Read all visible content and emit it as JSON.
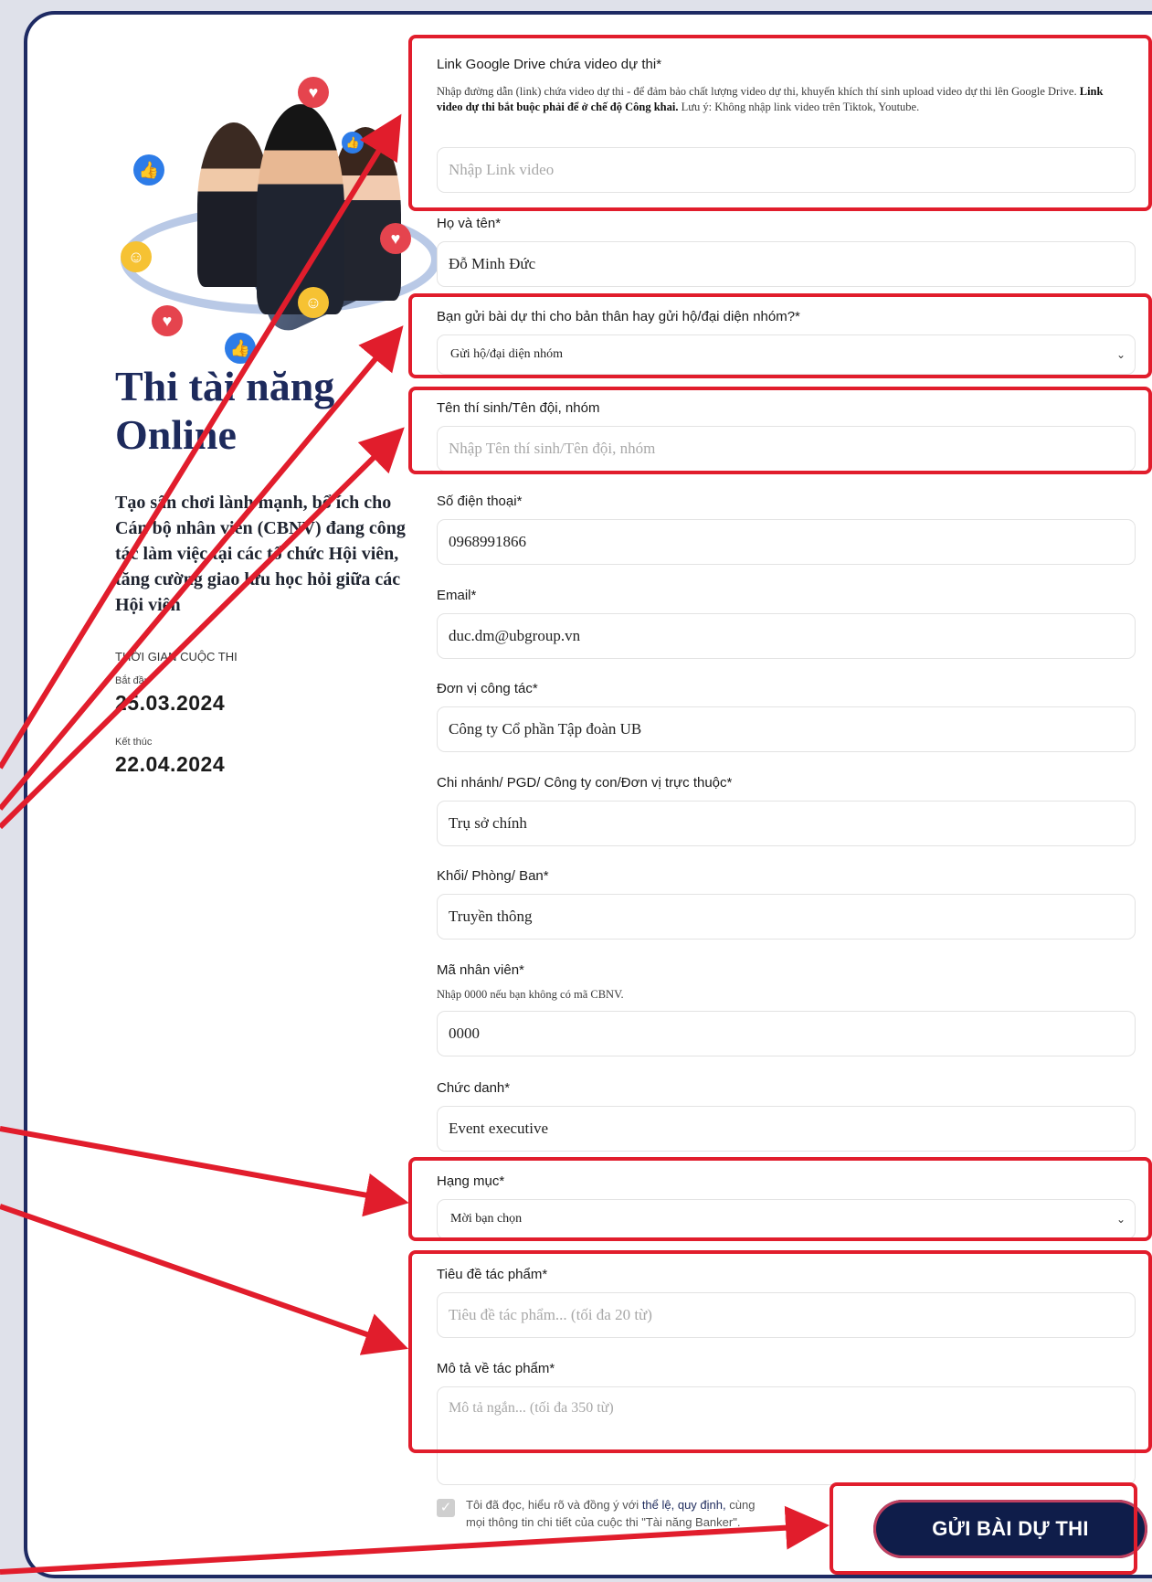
{
  "left": {
    "title": "Thi tài năng Online",
    "description": "Tạo sân chơi lành mạnh, bổ ích cho Cán bộ nhân viên (CBNV) đang công tác làm việc tại các tổ chức Hội viên, tăng cường giao lưu học hỏi giữa các Hội viên",
    "time_caption": "THỜI GIAN CUỘC THI",
    "start_label": "Bắt đầu",
    "start_date": "25.03.2024",
    "end_label": "Kết thúc",
    "end_date": "22.04.2024",
    "hero_icons": [
      "heart-icon",
      "like-icon",
      "hug-emoji-icon"
    ]
  },
  "form": {
    "video_link": {
      "label": "Link Google Drive chứa video dự thi*",
      "help_plain": "Nhập đường dẫn (link) chứa video dự thi - để đảm bảo chất lượng video dự thi, khuyến khích thí sinh upload video dự thi lên Google Drive.",
      "help_bold": "Link video dự thi bắt buộc phải để ở chế độ Công khai.",
      "help_note": "Lưu ý: Không nhập link video trên Tiktok, Youtube.",
      "placeholder": "Nhập Link video"
    },
    "full_name": {
      "label": "Họ và tên*",
      "value": "Đỗ Minh Đức"
    },
    "submit_for": {
      "label": "Bạn gửi bài dự thi cho bản thân hay gửi hộ/đại diện nhóm?*",
      "selected": "Gửi hộ/đại diện nhóm"
    },
    "team_name": {
      "label": "Tên thí sinh/Tên đội, nhóm",
      "placeholder": "Nhập  Tên thí sinh/Tên đội, nhóm"
    },
    "phone": {
      "label": "Số điện thoại*",
      "value": "0968991866"
    },
    "email": {
      "label": "Email*",
      "value": "duc.dm@ubgroup.vn"
    },
    "organization": {
      "label": "Đơn vị công tác*",
      "value": "Công ty Cổ phần Tập đoàn UB"
    },
    "branch": {
      "label": "Chi nhánh/ PGD/ Công ty con/Đơn vị trực thuộc*",
      "value": "Trụ sở chính"
    },
    "department": {
      "label": "Khối/ Phòng/ Ban*",
      "value": "Truyền thông"
    },
    "employee_id": {
      "label": "Mã nhân viên*",
      "help": "Nhập 0000 nếu bạn không có mã CBNV.",
      "value": "0000"
    },
    "position": {
      "label": "Chức danh*",
      "value": "Event executive"
    },
    "category": {
      "label": "Hạng mục*",
      "selected": "Mời bạn chọn"
    },
    "work_title": {
      "label": "Tiêu đề tác phẩm*",
      "placeholder": "Tiêu đề tác phẩm... (tối đa 20 từ)"
    },
    "work_desc": {
      "label": "Mô tả về tác phẩm*",
      "placeholder": "Mô tả ngắn... (tối đa 350 từ)"
    },
    "agree": {
      "prefix": "Tôi đã đọc, hiểu rõ và đồng ý với",
      "link": "thể lệ, quy định,",
      "suffix": "cùng mọi thông tin chi tiết của cuộc thi \"Tài năng Banker\"."
    },
    "submit_label": "GỬI BÀI DỰ THI"
  },
  "colors": {
    "accent": "#1d2a5c",
    "button": "#0f1d4a",
    "annotation": "#e11d2c"
  }
}
